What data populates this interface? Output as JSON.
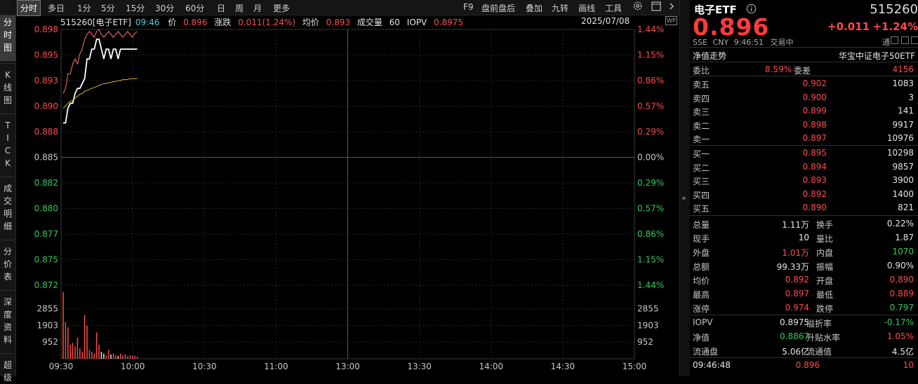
{
  "toolbar": {
    "tabs": [
      "分时",
      "多日",
      "1分",
      "5分",
      "15分",
      "30分",
      "60分",
      "日",
      "周",
      "月",
      "更多"
    ],
    "right_items": [
      "F9",
      "盘前盘后",
      "叠加",
      "九转",
      "画线",
      "工具"
    ]
  },
  "left_tabs": [
    {
      "label": "分\n时\n图"
    },
    {
      "label": "K\n线\n图"
    },
    {
      "label": "T\nI\nC\nK"
    },
    {
      "label": "成\n交\n明\n细"
    },
    {
      "label": "分\n价\n表"
    },
    {
      "label": "深\n度\n资\n料"
    },
    {
      "label": "超\n级"
    }
  ],
  "chart_header": {
    "code_name": "515260[电子ETF]",
    "time": "09:46",
    "price_label": "价",
    "price": "0.896",
    "change_label": "涨跌",
    "change": "0.011(1.24%)",
    "avg_label": "均价",
    "avg": "0.893",
    "vol_label": "成交量",
    "vol": "60",
    "iopv_label": "IOPV",
    "iopv": "0.8975",
    "date": "2025/07/08"
  },
  "chart_data": {
    "type": "line",
    "price_axis": [
      "0.898",
      "0.895",
      "0.893",
      "0.890",
      "0.888",
      "0.885",
      "0.882",
      "0.880",
      "0.877",
      "0.875",
      "0.872"
    ],
    "pct_axis": [
      "1.44%",
      "1.15%",
      "0.86%",
      "0.57%",
      "0.29%",
      "0.00%",
      "0.29%",
      "0.57%",
      "0.86%",
      "1.15%",
      "1.44%"
    ],
    "vol_axis": [
      "2855",
      "1903",
      "952"
    ],
    "x_ticks": [
      "09:30",
      "10:00",
      "10:30",
      "11:00",
      "13:00",
      "13:30",
      "14:00",
      "14:30",
      "15:00"
    ],
    "ylim": [
      0.872,
      0.898
    ],
    "prev_close": 0.885,
    "series": [
      {
        "values": [
          0.8885,
          0.8885,
          0.89,
          0.8905,
          0.8905,
          0.8915,
          0.892,
          0.892,
          0.8925,
          0.893,
          0.895,
          0.895,
          0.896,
          0.896,
          0.897,
          0.897,
          0.896,
          0.895,
          0.896,
          0.896,
          0.895,
          0.896,
          0.896,
          0.895,
          0.896,
          0.896,
          0.896,
          0.896,
          0.896,
          0.896,
          0.896,
          0.896
        ],
        "color": "#ffffff"
      },
      {
        "values": [
          0.89,
          0.8902,
          0.8905,
          0.8907,
          0.8908,
          0.891,
          0.8912,
          0.8914,
          0.8915,
          0.8917,
          0.8918,
          0.8919,
          0.892,
          0.8921,
          0.8922,
          0.8923,
          0.8924,
          0.8925,
          0.8925,
          0.8926,
          0.8926,
          0.8927,
          0.8927,
          0.8928,
          0.8928,
          0.8929,
          0.8929,
          0.8929,
          0.893,
          0.893,
          0.893,
          0.893
        ],
        "color": "#e0b030"
      },
      {
        "values": [
          0.8915,
          0.892,
          0.8935,
          0.8935,
          0.8945,
          0.895,
          0.8945,
          0.8955,
          0.896,
          0.897,
          0.8975,
          0.8978,
          0.8975,
          0.8972,
          0.8978,
          0.898,
          0.8975,
          0.8972,
          0.8975,
          0.8978,
          0.8975,
          0.8972,
          0.8975,
          0.8978,
          0.8975,
          0.8972,
          0.8975,
          0.8978,
          0.8975,
          0.8972,
          0.8976,
          0.8978
        ],
        "color": "#ff7070"
      }
    ],
    "volume": [
      3800,
      2100,
      1800,
      800,
      900,
      700,
      1200,
      600,
      400,
      2500,
      1900,
      500,
      400,
      300,
      1500,
      800,
      400,
      300,
      200,
      500,
      250,
      300,
      200,
      150,
      300,
      200,
      250,
      150,
      200,
      180,
      160,
      120
    ],
    "vol_max": 3806
  },
  "quote": {
    "name": "电子ETF",
    "code": "515260",
    "price": "0.896",
    "change": "+0.011",
    "change_pct": "+1.24%",
    "market": "SSE",
    "currency": "CNY",
    "time": "9:46:51",
    "status": "交易中",
    "tong": "通",
    "nav_trend": "净值走势",
    "index_name": "华宝中证电子50ETF",
    "weibi_label": "委比",
    "weibi": "8.59%",
    "weicha_label": "委差",
    "weicha": "4156",
    "asks": [
      {
        "label": "卖五",
        "price": "0.902",
        "vol": "1083"
      },
      {
        "label": "卖四",
        "price": "0.900",
        "vol": "3"
      },
      {
        "label": "卖三",
        "price": "0.899",
        "vol": "141"
      },
      {
        "label": "卖二",
        "price": "0.898",
        "vol": "9917"
      },
      {
        "label": "卖一",
        "price": "0.897",
        "vol": "10976"
      }
    ],
    "bids": [
      {
        "label": "买一",
        "price": "0.895",
        "vol": "10298"
      },
      {
        "label": "买二",
        "price": "0.894",
        "vol": "9857"
      },
      {
        "label": "买三",
        "price": "0.893",
        "vol": "3900"
      },
      {
        "label": "买四",
        "price": "0.892",
        "vol": "1400"
      },
      {
        "label": "买五",
        "price": "0.890",
        "vol": "821"
      }
    ],
    "stats": [
      {
        "l1": "总量",
        "v1": "1.11万",
        "c1": "white",
        "l2": "换手",
        "v2": "0.22%",
        "c2": "white"
      },
      {
        "l1": "现手",
        "v1": "10",
        "c1": "white",
        "l2": "量比",
        "v2": "1.87",
        "c2": "white"
      },
      {
        "l1": "外盘",
        "v1": "1.01万",
        "c1": "red",
        "l2": "内盘",
        "v2": "1070",
        "c2": "green"
      },
      {
        "l1": "总额",
        "v1": "99.33万",
        "c1": "white",
        "l2": "振幅",
        "v2": "0.90%",
        "c2": "white"
      },
      {
        "l1": "均价",
        "v1": "0.892",
        "c1": "red",
        "l2": "开盘",
        "v2": "0.890",
        "c2": "red"
      },
      {
        "l1": "最高",
        "v1": "0.897",
        "c1": "red",
        "l2": "最低",
        "v2": "0.889",
        "c2": "red"
      },
      {
        "l1": "涨停",
        "v1": "0.974",
        "c1": "red",
        "l2": "跌停",
        "v2": "0.797",
        "c2": "green"
      }
    ],
    "stats2": [
      {
        "l1": "IOPV",
        "v1": "0.8975",
        "c1": "white",
        "l2": "溢折率",
        "v2": "-0.17%",
        "c2": "green"
      },
      {
        "l1": "净值",
        "v1": "0.8867",
        "c1": "green",
        "l2": "升贴水率",
        "v2": "1.05%",
        "c2": "red"
      },
      {
        "l1": "流通盘",
        "v1": "5.06亿",
        "c1": "white",
        "l2": "流通值",
        "v2": "4.5亿",
        "c2": "white"
      }
    ],
    "tick": {
      "time": "09:46:48",
      "price": "0.896",
      "vol": "10"
    }
  }
}
